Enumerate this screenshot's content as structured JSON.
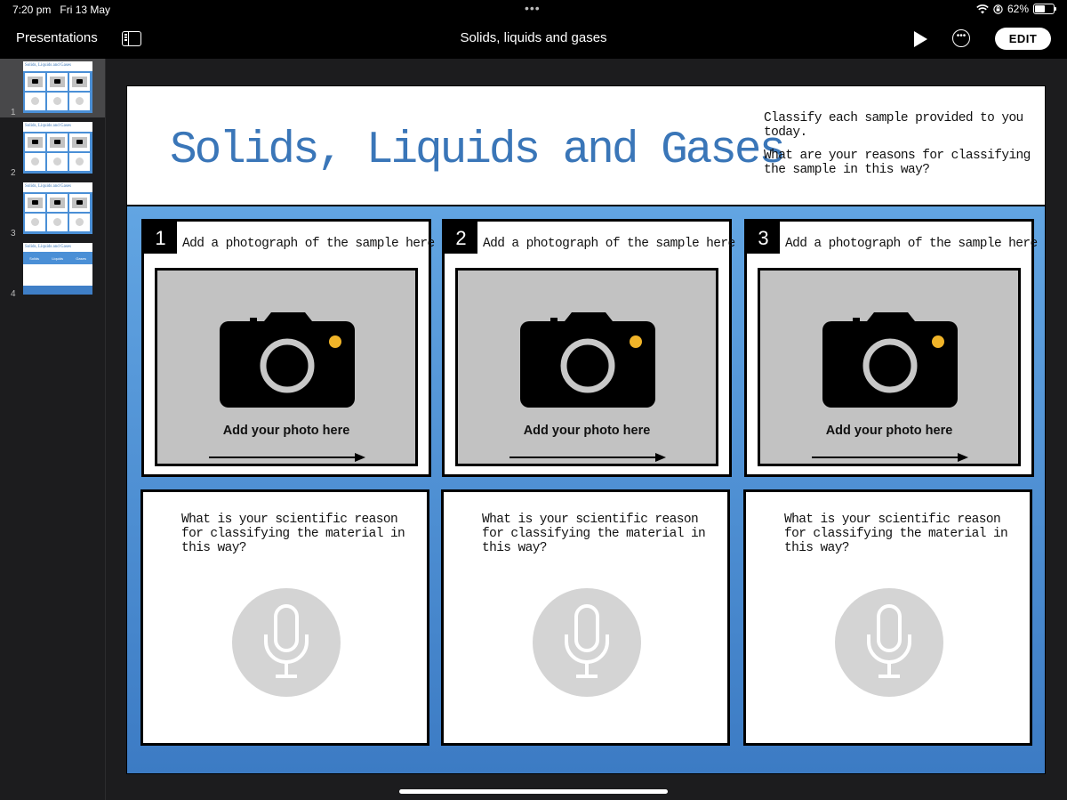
{
  "status_bar": {
    "time": "7:20 pm",
    "date": "Fri 13 May",
    "battery_percent": "62%",
    "battery_level": 0.62
  },
  "toolbar": {
    "back_label": "Presentations",
    "document_title": "Solids, liquids and gases",
    "edit_label": "EDIT"
  },
  "navigator": {
    "slides": [
      {
        "number": "1",
        "selected": true
      },
      {
        "number": "2",
        "selected": false
      },
      {
        "number": "3",
        "selected": false
      },
      {
        "number": "4",
        "selected": false
      }
    ],
    "thumb_title": "Solids, Liquids and Gases",
    "thumb4": {
      "columns": [
        "Solids",
        "Liquids",
        "Gases"
      ]
    }
  },
  "slide": {
    "title": "Solids, Liquids and Gases",
    "instructions": [
      "Classify each sample provided to you today.",
      "What are your reasons for classifying the sample in this way?"
    ],
    "photo_cards": [
      {
        "number": "1",
        "label": "Add a photograph of the sample here",
        "caption": "Add your photo here"
      },
      {
        "number": "2",
        "label": "Add a photograph of the sample here",
        "caption": "Add your photo here"
      },
      {
        "number": "3",
        "label": "Add a photograph of the sample here",
        "caption": "Add your photo here"
      }
    ],
    "reason_cards": [
      {
        "question": "What is your scientific reason for classifying the material in this way?"
      },
      {
        "question": "What is your scientific reason for classifying the material in this way?"
      },
      {
        "question": "What is your scientific reason for classifying the material in this way?"
      }
    ]
  },
  "colors": {
    "title_blue": "#3a76b8",
    "slide_gradient_top": "#6aaee9",
    "slide_gradient_bottom": "#3c7bc4",
    "camera_dot": "#f0b429",
    "mic_circle": "#d4d4d4",
    "photo_bg": "#c2c2c2"
  },
  "icons": [
    "wifi-icon",
    "orientation-lock-icon",
    "battery-icon",
    "sidebar-toggle-icon",
    "play-icon",
    "more-icon",
    "camera-icon",
    "microphone-icon",
    "arrow-right-icon"
  ]
}
